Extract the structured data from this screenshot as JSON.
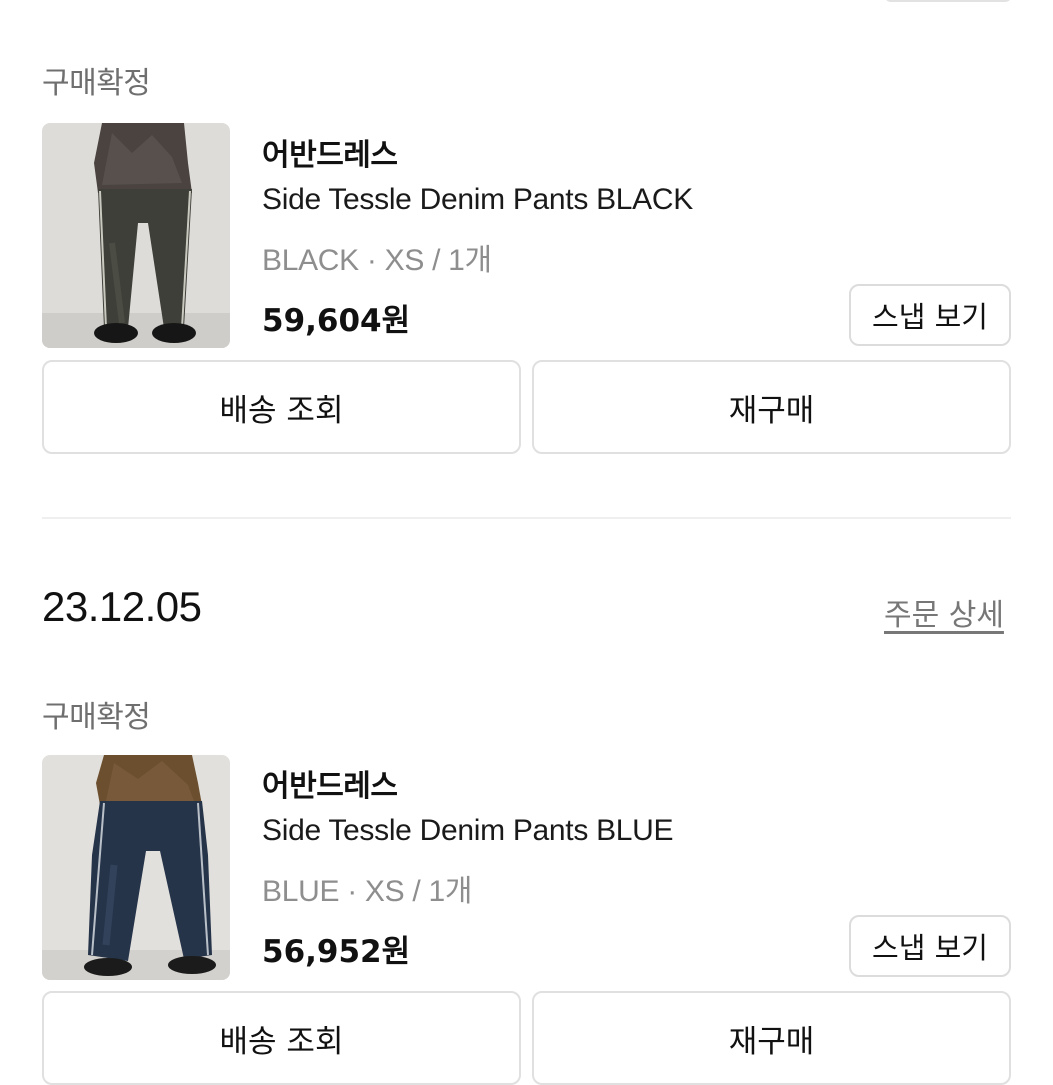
{
  "orders": [
    {
      "status": "구매확정",
      "brand": "어반드레스",
      "product_name": "Side Tessle Denim Pants BLACK",
      "option": "BLACK · XS / 1개",
      "price": "59,604원",
      "snap_label": "스냅 보기",
      "track_label": "배송 조회",
      "rebuy_label": "재구매",
      "thumbnail_icon": "black-denim-pants-photo"
    },
    {
      "date": "23.12.05",
      "detail_link": "주문 상세",
      "status": "구매확정",
      "brand": "어반드레스",
      "product_name": "Side Tessle Denim Pants BLUE",
      "option": "BLUE · XS / 1개",
      "price": "56,952원",
      "snap_label": "스냅 보기",
      "track_label": "배송 조회",
      "rebuy_label": "재구매",
      "thumbnail_icon": "blue-denim-pants-photo"
    }
  ],
  "colors": {
    "status_text": "#6f6f6f",
    "option_text": "#8e8e8e",
    "border": "#e0e0e0",
    "link_text": "#777777"
  }
}
